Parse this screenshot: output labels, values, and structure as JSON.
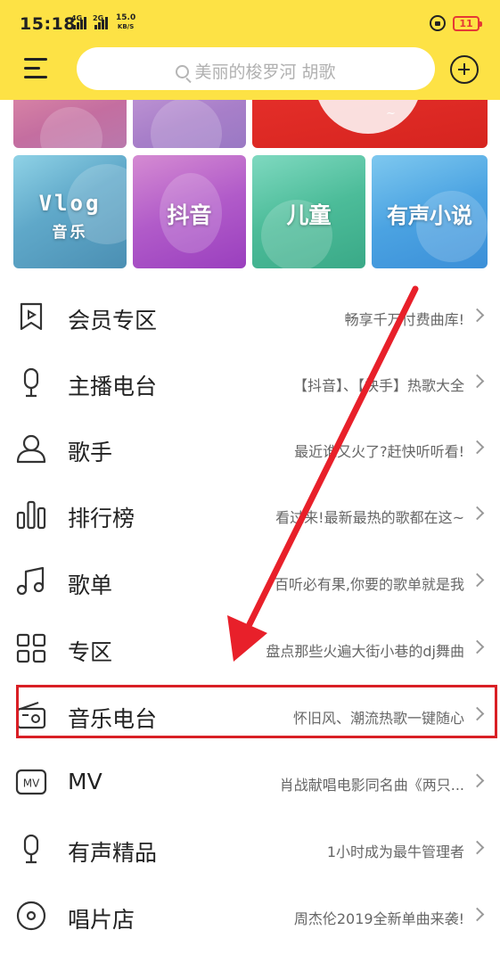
{
  "status_bar": {
    "time": "15:18",
    "network_1": "4G",
    "network_2": "2G",
    "speed_value": "15.0",
    "speed_unit": "KB/S",
    "battery": "11"
  },
  "header": {
    "search_placeholder": "美丽的梭罗河  胡歌"
  },
  "categories": {
    "vlog_title": "Vlog",
    "vlog_sub": "音乐",
    "douyin": "抖音",
    "children": "儿童",
    "audio_novel": "有声小说"
  },
  "menu": [
    {
      "title": "会员专区",
      "subtitle": "畅享千万付费曲库!",
      "icon": "vip-bookmark-icon"
    },
    {
      "title": "主播电台",
      "subtitle": "【抖音】、【快手】热歌大全",
      "icon": "microphone-icon"
    },
    {
      "title": "歌手",
      "subtitle": "最近谁又火了?赶快听听看!",
      "icon": "person-icon"
    },
    {
      "title": "排行榜",
      "subtitle": "看过来!最新最热的歌都在这~",
      "icon": "bar-chart-icon"
    },
    {
      "title": "歌单",
      "subtitle": "百听必有果,你要的歌单就是我",
      "icon": "music-note-icon"
    },
    {
      "title": "专区",
      "subtitle": "盘点那些火遍大街小巷的dj舞曲",
      "icon": "grid-icon"
    },
    {
      "title": "音乐电台",
      "subtitle": "怀旧风、潮流热歌一键随心",
      "icon": "radio-icon"
    },
    {
      "title": "MV",
      "subtitle": "肖战献唱电影同名曲《两只...",
      "icon": "mv-icon"
    },
    {
      "title": "有声精品",
      "subtitle": "1小时成为最牛管理者",
      "icon": "microphone-icon"
    },
    {
      "title": "唱片店",
      "subtitle": "周杰伦2019全新单曲来袭!",
      "icon": "disc-icon"
    }
  ],
  "colors": {
    "header_bg": "#fde245",
    "highlight": "#d91f25",
    "battery": "#e53935"
  }
}
